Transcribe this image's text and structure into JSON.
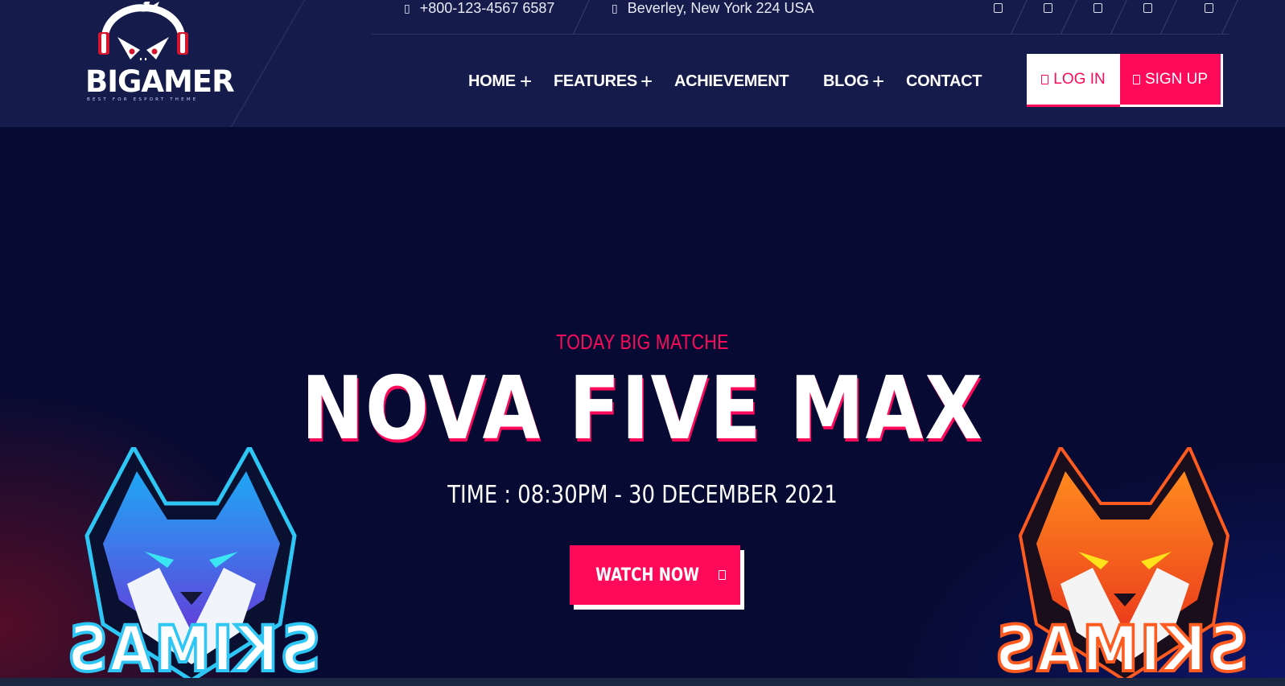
{
  "brand": {
    "name": "BIGAMER",
    "tagline": "BEST FOR ESPORT THEME"
  },
  "topbar": {
    "phone": "+800-123-4567 6587",
    "address": "Beverley, New York 224 USA",
    "phone_icon": "phone-icon",
    "address_icon": "location-icon",
    "socials": [
      "facebook-icon",
      "twitter-icon",
      "youtube-icon",
      "instagram-icon",
      "linkedin-icon"
    ]
  },
  "nav": {
    "items": [
      {
        "label": "HOME",
        "has_submenu": true
      },
      {
        "label": "FEATURES",
        "has_submenu": true
      },
      {
        "label": "ACHIEVEMENT",
        "has_submenu": false
      },
      {
        "label": "BLOG",
        "has_submenu": true
      },
      {
        "label": "CONTACT",
        "has_submenu": false
      }
    ],
    "submenu_symbol": "+"
  },
  "auth": {
    "login_label": "LOG IN",
    "signup_label": "SIGN UP"
  },
  "hero": {
    "subtitle": "TODAY BIG MATCHE",
    "title": "NOVA FIVE MAX",
    "time": "TIME : 08:30PM - 30 DECEMBER 2021",
    "watch_label": "WATCH NOW",
    "left_team_text": "SKIMAS",
    "right_team_text": "SKIMAS"
  },
  "colors": {
    "accent": "#ff0a5a",
    "header_bg": "#151b4a",
    "hero_bg": "#070b33"
  }
}
